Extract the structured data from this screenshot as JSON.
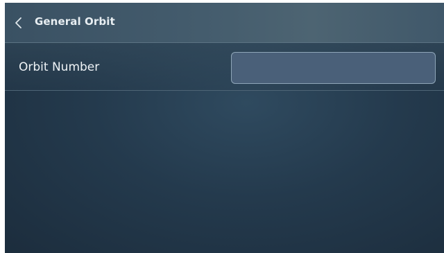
{
  "header": {
    "title": "General Orbit",
    "back_icon": "chevron-left-icon"
  },
  "settings": {
    "orbit_number": {
      "label": "Orbit Number",
      "value": "",
      "placeholder": ""
    }
  },
  "colors": {
    "background": "#243a4d",
    "header": "#445c6d",
    "field_fill": "#4a6079",
    "field_border": "#8fa6b8",
    "text": "#eef3f6"
  }
}
